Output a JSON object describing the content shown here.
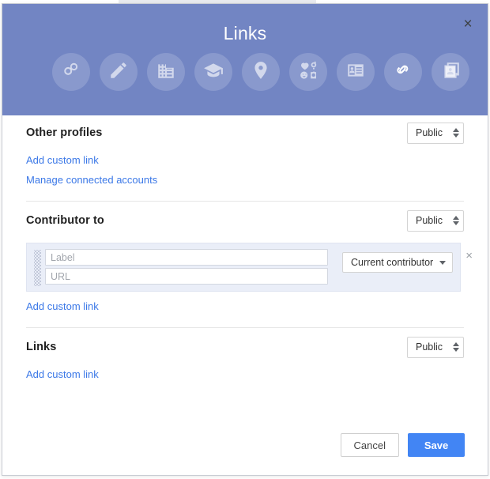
{
  "dialog": {
    "title": "Links",
    "close_label": "×"
  },
  "header_icons": [
    {
      "name": "about-rings-icon",
      "label": "About"
    },
    {
      "name": "pencil-icon",
      "label": "Story"
    },
    {
      "name": "building-icon",
      "label": "Work"
    },
    {
      "name": "graduation-cap-icon",
      "label": "Education"
    },
    {
      "name": "location-pin-icon",
      "label": "Places"
    },
    {
      "name": "basic-info-icon",
      "label": "Basic information"
    },
    {
      "name": "contact-card-icon",
      "label": "Contact information"
    },
    {
      "name": "link-chain-icon",
      "label": "Links",
      "active": true
    },
    {
      "name": "apps-copy-icon",
      "label": "Apps"
    }
  ],
  "sections": [
    {
      "title": "Other profiles",
      "visibility": "Public",
      "links": [
        "Add custom link",
        "Manage connected accounts"
      ]
    },
    {
      "title": "Contributor to",
      "visibility": "Public",
      "entry": {
        "label_placeholder": "Label",
        "label_value": "",
        "url_placeholder": "URL",
        "url_value": "",
        "contributor_status": "Current contributor",
        "remove_label": "×"
      },
      "links": [
        "Add custom link"
      ]
    },
    {
      "title": "Links",
      "visibility": "Public",
      "links": [
        "Add custom link"
      ]
    }
  ],
  "footer": {
    "cancel_label": "Cancel",
    "save_label": "Save"
  },
  "colors": {
    "header_blue": "#7285c3",
    "link_blue": "#3b78e7",
    "primary_button": "#4285f4",
    "entry_panel": "#eaeef8"
  }
}
